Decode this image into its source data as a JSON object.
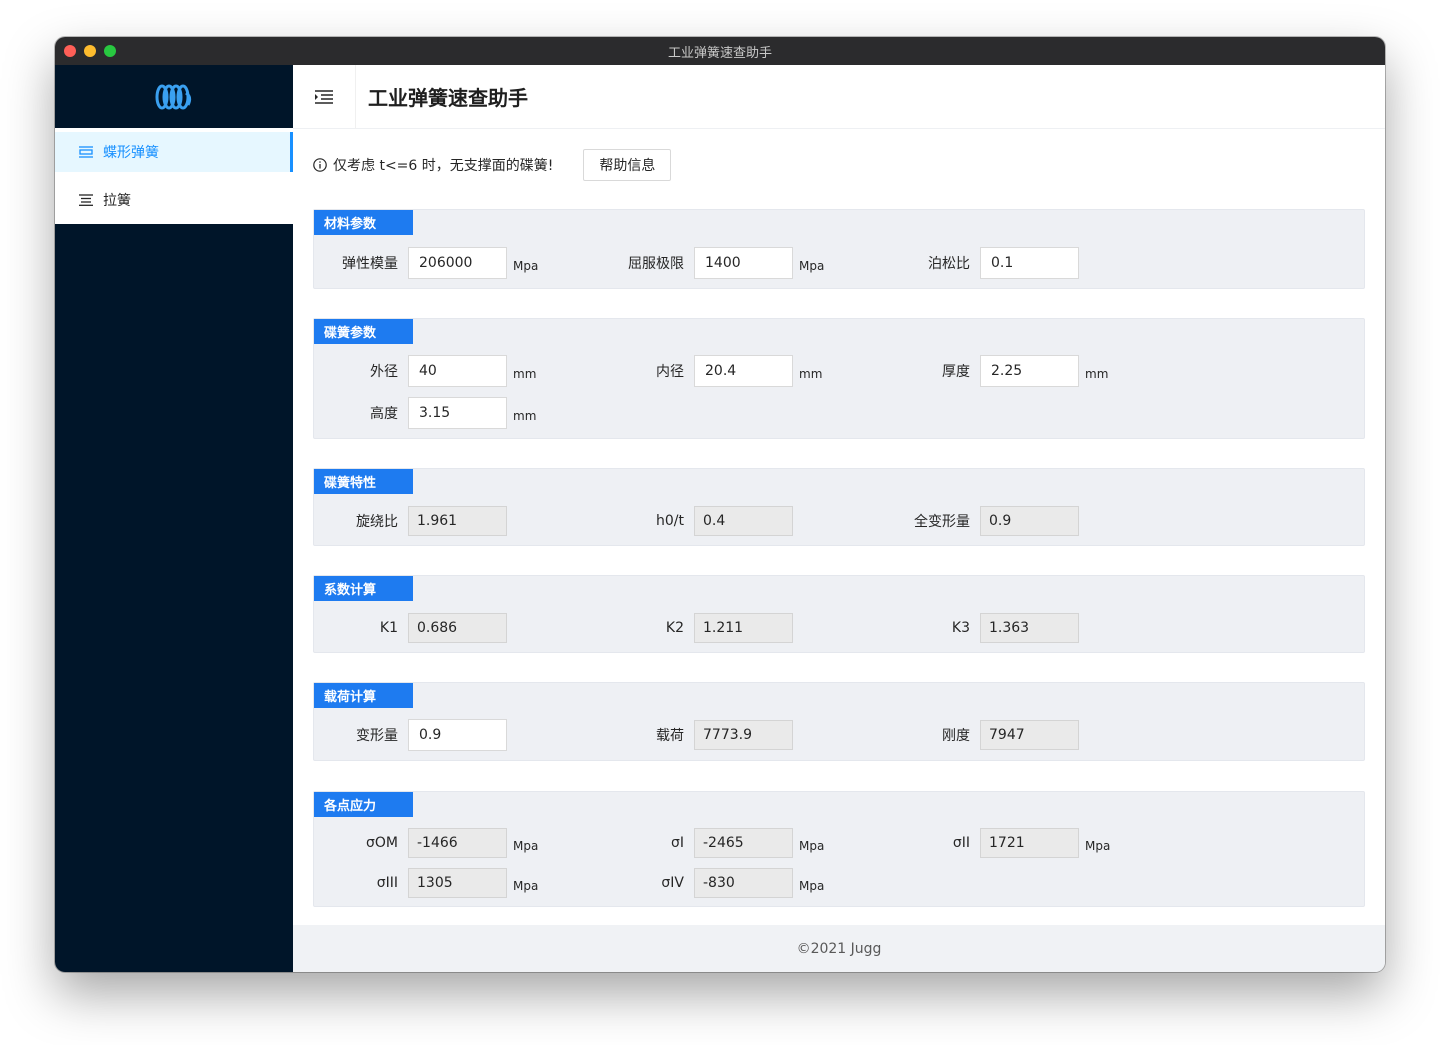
{
  "window": {
    "title": "工业弹簧速查助手"
  },
  "header": {
    "title": "工业弹簧速查助手"
  },
  "sidebar": {
    "items": [
      {
        "label": "蝶形弹簧",
        "active": true
      },
      {
        "label": "拉簧",
        "active": false
      }
    ]
  },
  "notice": {
    "text": "仅考虑 t<=6 时，无支撑面的碟簧!",
    "help_label": "帮助信息"
  },
  "sections": {
    "material": {
      "title": "材料参数",
      "elastic_label": "弹性模量",
      "elastic_value": "206000",
      "elastic_unit": "Mpa",
      "yield_label": "屈服极限",
      "yield_value": "1400",
      "yield_unit": "Mpa",
      "poisson_label": "泊松比",
      "poisson_value": "0.1"
    },
    "disc": {
      "title": "碟簧参数",
      "outer_label": "外径",
      "outer_value": "40",
      "outer_unit": "mm",
      "inner_label": "内径",
      "inner_value": "20.4",
      "inner_unit": "mm",
      "thick_label": "厚度",
      "thick_value": "2.25",
      "thick_unit": "mm",
      "height_label": "高度",
      "height_value": "3.15",
      "height_unit": "mm"
    },
    "props": {
      "title": "碟簧特性",
      "ratio_label": "旋绕比",
      "ratio_value": "1.961",
      "h0t_label": "h0/t",
      "h0t_value": "0.4",
      "full_label": "全变形量",
      "full_value": "0.9"
    },
    "coef": {
      "title": "系数计算",
      "k1_label": "K1",
      "k1_value": "0.686",
      "k2_label": "K2",
      "k2_value": "1.211",
      "k3_label": "K3",
      "k3_value": "1.363"
    },
    "load": {
      "title": "载荷计算",
      "deform_label": "变形量",
      "deform_value": "0.9",
      "load_label": "载荷",
      "load_value": "7773.9",
      "stiff_label": "刚度",
      "stiff_value": "7947"
    },
    "stress": {
      "title": "各点应力",
      "som_label": "σOM",
      "som_value": "-1466",
      "som_unit": "Mpa",
      "s1_label": "σI",
      "s1_value": "-2465",
      "s1_unit": "Mpa",
      "s2_label": "σII",
      "s2_value": "1721",
      "s2_unit": "Mpa",
      "s3_label": "σIII",
      "s3_value": "1305",
      "s3_unit": "Mpa",
      "s4_label": "σIV",
      "s4_value": "-830",
      "s4_unit": "Mpa"
    }
  },
  "footer": {
    "text": "©2021 Jugg"
  },
  "colors": {
    "sidebar_bg": "#001529",
    "accent": "#1890ff",
    "section_tag": "#1e7bf0"
  }
}
